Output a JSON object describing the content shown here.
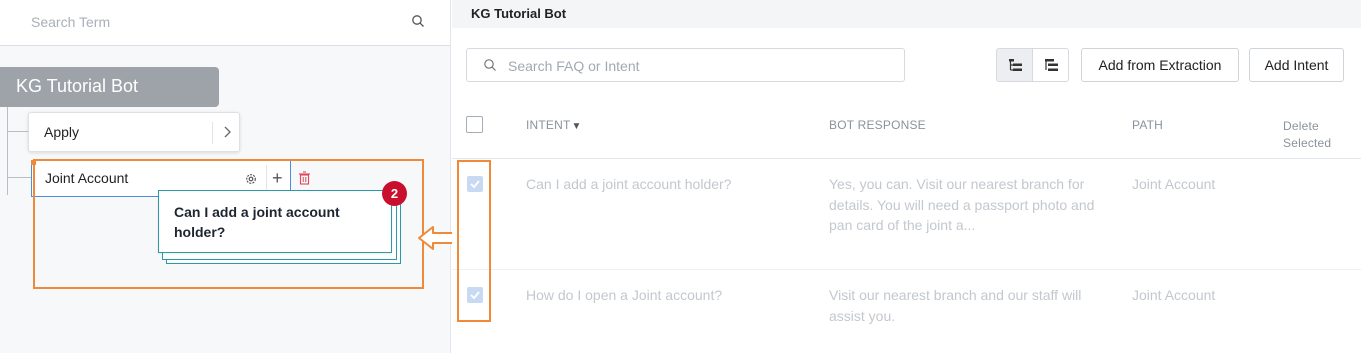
{
  "left_panel": {
    "search": {
      "placeholder": "Search Term"
    },
    "tree": {
      "root_label": "KG Tutorial Bot",
      "nodes": [
        {
          "label": "Apply"
        },
        {
          "label": "Joint Account"
        }
      ]
    },
    "drag_preview": {
      "question": "Can I add a joint account holder?",
      "count_badge": "2"
    }
  },
  "right_panel": {
    "title": "KG Tutorial Bot",
    "search": {
      "placeholder": "Search FAQ or Intent"
    },
    "toolbar": {
      "add_from_extraction": "Add from Extraction",
      "add_intent": "Add Intent"
    },
    "table": {
      "columns": {
        "intent": "INTENT",
        "bot_response": "BOT RESPONSE",
        "path": "PATH",
        "delete_line1": "Delete",
        "delete_line2": "Selected"
      },
      "rows": [
        {
          "checked": true,
          "intent": "Can I add a joint account holder?",
          "response_line1": "Yes, you can. Visit our nearest branch for",
          "response_line2": "details. You will need a passport photo and",
          "response_line3": "pan card of the joint a...",
          "path": "Joint Account"
        },
        {
          "checked": true,
          "intent": "How do I open a Joint account?",
          "response_line1": "Visit our nearest branch and our staff will",
          "response_line2": "assist you.",
          "path": "Joint Account"
        }
      ]
    }
  },
  "colors": {
    "highlight": "#f08a3b",
    "badge": "#c8102e",
    "card_border": "#2a9aa3",
    "selected_node_border": "#4a8fd8",
    "root_node_bg": "#9ea3aa"
  }
}
